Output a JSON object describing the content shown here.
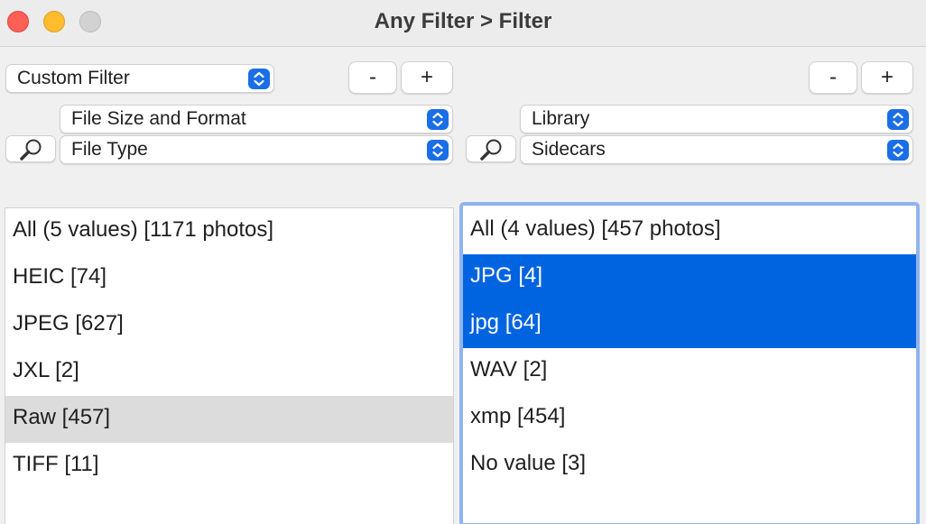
{
  "window": {
    "title": "Any Filter > Filter"
  },
  "toolbar": {
    "filter_preset": "Custom Filter",
    "minus_label": "-",
    "plus_label": "+"
  },
  "left_column": {
    "category": "File Size and Format",
    "field": "File Type",
    "items": [
      {
        "label": "All (5 values) [1171 photos]"
      },
      {
        "label": "HEIC [74]"
      },
      {
        "label": "JPEG [627]"
      },
      {
        "label": "JXL [2]"
      },
      {
        "label": "Raw [457]"
      },
      {
        "label": "TIFF [11]"
      }
    ]
  },
  "right_column": {
    "category": "Library",
    "field": "Sidecars",
    "items": [
      {
        "label": "All (4 values) [457 photos]"
      },
      {
        "label": "JPG [4]"
      },
      {
        "label": "jpg [64]"
      },
      {
        "label": "WAV [2]"
      },
      {
        "label": "xmp [454]"
      },
      {
        "label": "No value [3]"
      }
    ]
  },
  "icons": {
    "search": "magnifier-icon",
    "stepper": "chevron-up-down-icon"
  },
  "colors": {
    "selection": "#0064e1",
    "accent": "#1a6ee6",
    "focus_ring": "#8fb4ef",
    "hover_row": "#dcdcdc"
  }
}
